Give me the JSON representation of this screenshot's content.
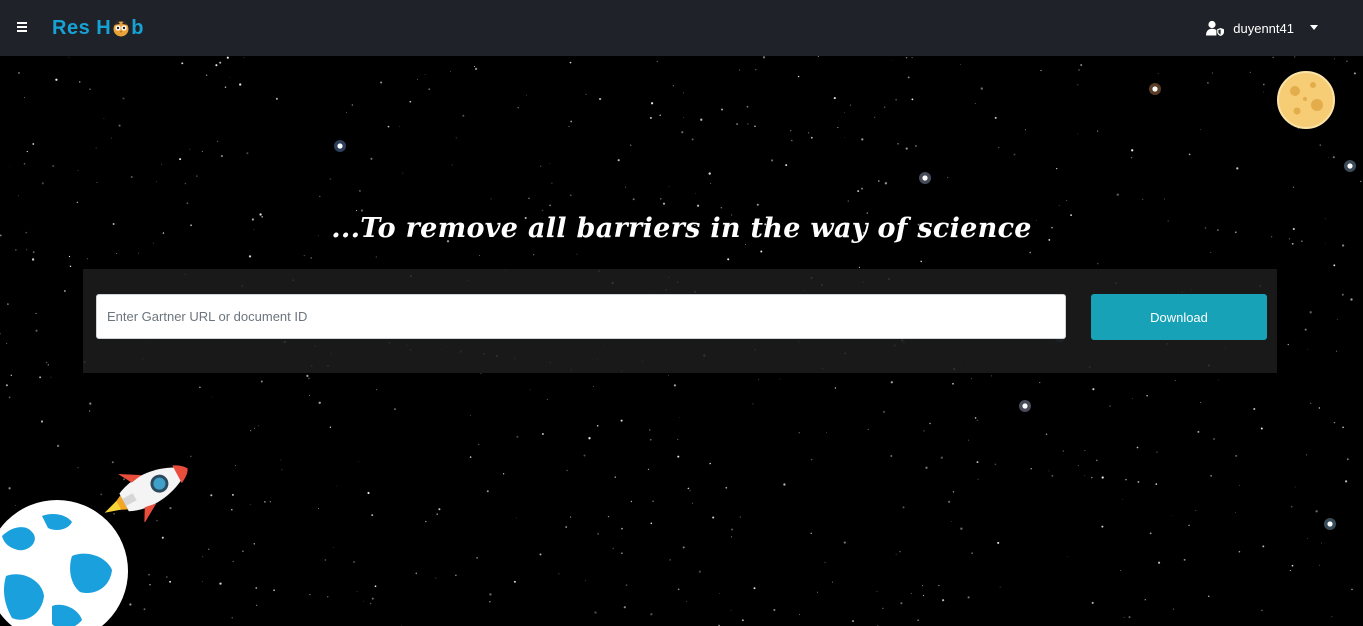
{
  "header": {
    "logo_text_before": "Res H",
    "logo_text_after": "b",
    "menu_icon": "hamburger-icon",
    "user": {
      "icon": "user-shield-icon",
      "name": "duyennt41",
      "dropdown_icon": "caret-down-icon"
    },
    "background_color": "#1f2329",
    "brand_color": "#17a2d6"
  },
  "hero": {
    "tagline": "...To remove all barriers in the way of science",
    "search": {
      "placeholder": "Enter Gartner URL or document ID",
      "value": ""
    },
    "download_label": "Download",
    "accent_color": "#17a2b8"
  },
  "decorations": [
    "moon-icon",
    "rocket-icon",
    "earth-icon"
  ]
}
